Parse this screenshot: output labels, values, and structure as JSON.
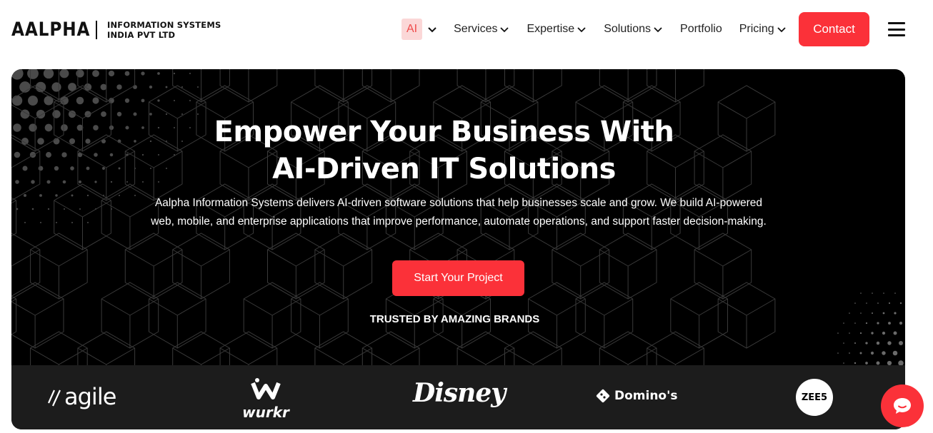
{
  "header": {
    "logo": {
      "main": "AALPHA",
      "sub_line1": "INFORMATION SYSTEMS",
      "sub_line2": "INDIA PVT LTD"
    },
    "nav": [
      {
        "label": "AI",
        "has_dropdown": true,
        "active": true
      },
      {
        "label": "Services",
        "has_dropdown": true
      },
      {
        "label": "Expertise",
        "has_dropdown": true
      },
      {
        "label": "Solutions",
        "has_dropdown": true
      },
      {
        "label": "Portfolio",
        "has_dropdown": false
      },
      {
        "label": "Pricing",
        "has_dropdown": true
      }
    ],
    "contact_label": "Contact",
    "menu_icon": "hamburger-icon"
  },
  "hero": {
    "title_line1": "Empower Your Business With",
    "title_line2": "AI-Driven IT Solutions",
    "description": "Aalpha Information Systems delivers AI-driven software solutions that help businesses scale and grow. We build AI-powered web, mobile, and enterprise applications that improve performance, automate operations, and support faster decision-making.",
    "cta_label": "Start Your Project",
    "trusted_label": "TRUSTED BY AMAZING BRANDS"
  },
  "brands": [
    {
      "name": "agile",
      "icon": "agile-logo"
    },
    {
      "name": "wurkr",
      "icon": "wurkr-logo"
    },
    {
      "name": "Disney",
      "icon": "disney-logo"
    },
    {
      "name": "Domino's",
      "icon": "dominos-logo"
    },
    {
      "name": "ZEE5",
      "icon": "zee5-logo"
    }
  ],
  "chat_widget": {
    "icon": "chat-icon"
  },
  "colors": {
    "accent": "#fb3139",
    "ai_highlight_bg": "#fbd7d7",
    "ai_highlight_text": "#ef4b4b",
    "hero_bg": "#000000",
    "brands_bg": "#1c1c1c"
  }
}
